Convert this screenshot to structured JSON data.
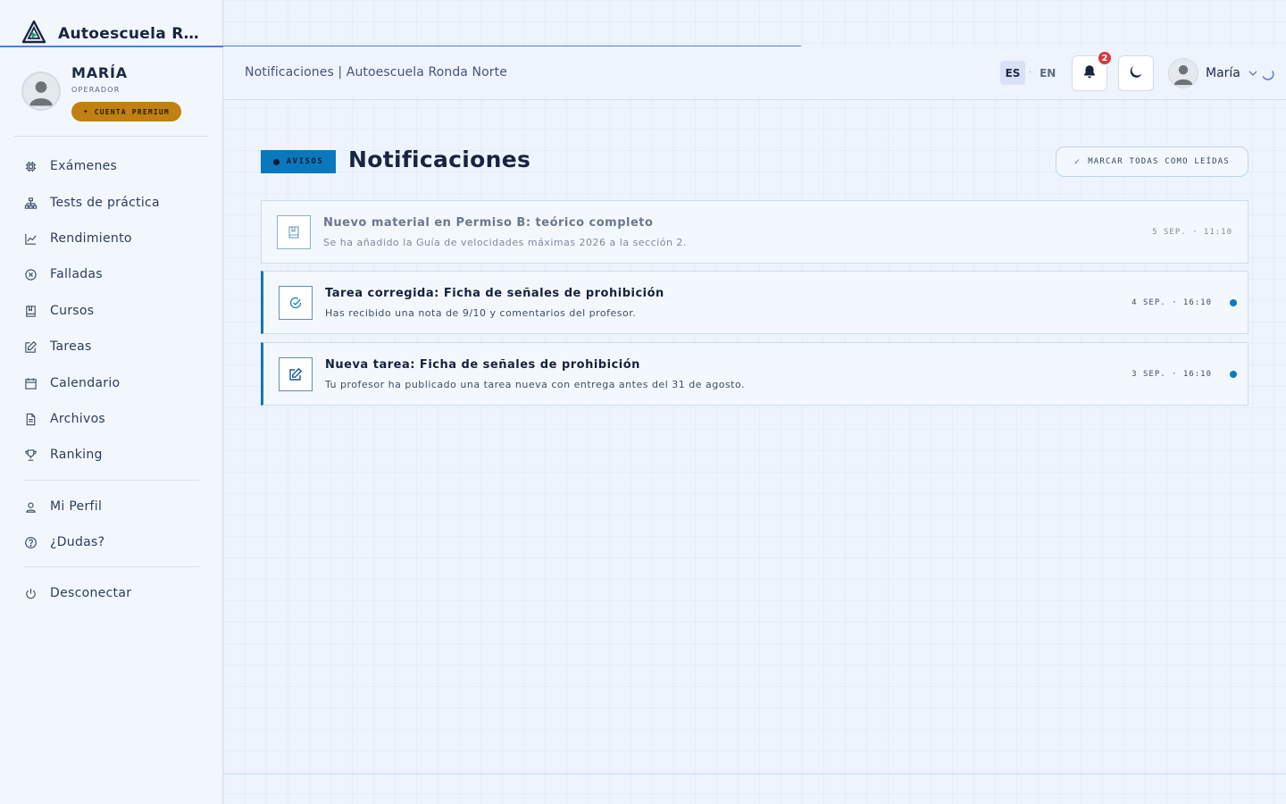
{
  "brand": {
    "name": "Autoescuela Ronda Norte"
  },
  "user": {
    "name": "MARÍA",
    "role": "OPERADOR",
    "badge": "CUENTA PREMIUM",
    "menu_name": "María"
  },
  "sidebar": {
    "items": [
      {
        "label": "Exámenes",
        "icon": "chip-icon"
      },
      {
        "label": "Tests de práctica",
        "icon": "hierarchy-icon"
      },
      {
        "label": "Rendimiento",
        "icon": "chart-line-icon"
      },
      {
        "label": "Falladas",
        "icon": "x-circle-icon"
      },
      {
        "label": "Cursos",
        "icon": "book-icon"
      },
      {
        "label": "Tareas",
        "icon": "edit-icon"
      },
      {
        "label": "Calendario",
        "icon": "calendar-icon"
      },
      {
        "label": "Archivos",
        "icon": "file-icon"
      },
      {
        "label": "Ranking",
        "icon": "trophy-icon"
      }
    ],
    "secondary": [
      {
        "label": "Mi Perfil",
        "icon": "user-icon"
      },
      {
        "label": "¿Dudas?",
        "icon": "help-icon"
      }
    ],
    "logout": {
      "label": "Desconectar",
      "icon": "power-icon"
    }
  },
  "topbar": {
    "breadcrumb": "Notificaciones | Autoescuela Ronda Norte",
    "lang_es": "ES",
    "lang_sep": "·",
    "lang_en": "EN",
    "notif_count": "2"
  },
  "main": {
    "tag": "AVISOS",
    "title": "Notificaciones",
    "mark_all": "MARCAR TODAS COMO LEÍDAS",
    "notifications": [
      {
        "title": "Nuevo material en Permiso B: teórico completo",
        "desc": "Se ha añadido la Guía de velocidades máximas 2026 a la sección 2.",
        "time": "5 SEP. · 11:10",
        "read": true,
        "icon": "book-icon"
      },
      {
        "title": "Tarea corregida: Ficha de señales de prohibición",
        "desc": "Has recibido una nota de 9/10 y comentarios del profesor.",
        "time": "4 SEP. · 16:10",
        "read": false,
        "icon": "check-circle-icon"
      },
      {
        "title": "Nueva tarea: Ficha de señales de prohibición",
        "desc": "Tu profesor ha publicado una tarea nueva con entrega antes del 31 de agosto.",
        "time": "3 SEP. · 16:10",
        "read": false,
        "icon": "edit-icon"
      }
    ]
  },
  "colors": {
    "accent": "#0a78bd",
    "premium": "#c08112",
    "badge": "#d63a3a",
    "progress": "#4e7fd6"
  }
}
